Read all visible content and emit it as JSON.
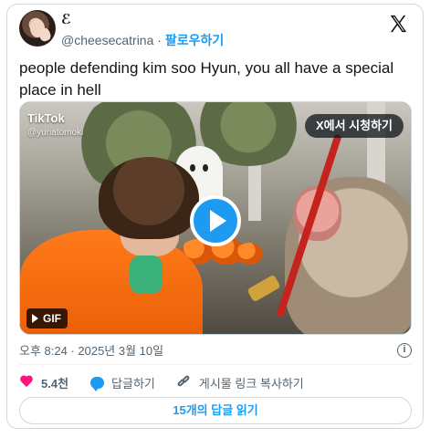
{
  "author": {
    "display_name": "ℰ",
    "handle": "@cheesecatrina",
    "separator": "·",
    "follow_label": "팔로우하기"
  },
  "tweet": {
    "text": "people defending kim soo Hyun, you all have a special place in hell"
  },
  "media": {
    "watermark_brand": "TikTok",
    "watermark_handle": "@yuriatomoki",
    "watch_on_x_label": "X에서 시청하기",
    "gif_label": "GIF"
  },
  "meta": {
    "timestamp": "오후 8:24 · 2025년 3월 10일",
    "info_icon": "info-icon"
  },
  "actions": {
    "like_count": "5.4천",
    "reply_label": "답글하기",
    "copy_link_label": "게시물 링크 복사하기"
  },
  "replies_button_label": "15개의 답글 읽기",
  "colors": {
    "accent": "#1d9bf0",
    "like": "#f91880",
    "muted_text": "#536471",
    "border": "#cfd9de"
  }
}
